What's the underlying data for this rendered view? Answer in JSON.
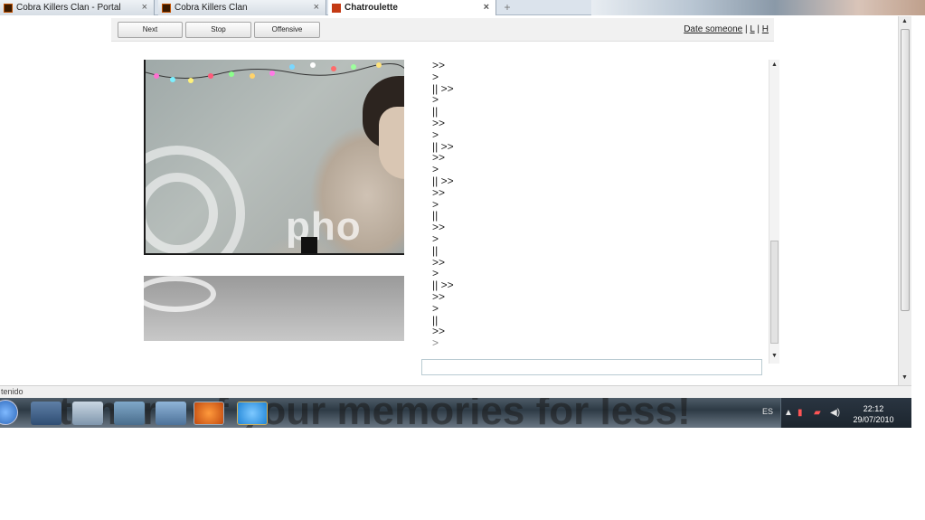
{
  "tabs": [
    {
      "label": "Cobra Killers Clan - Portal",
      "favicon": "cobra-clan-icon"
    },
    {
      "label": "Cobra Killers Clan",
      "favicon": "cobra-clan-icon"
    },
    {
      "label": "Chatroulette",
      "favicon": "chatroulette-icon"
    }
  ],
  "new_tab_glyph": "+",
  "close_glyph": "×",
  "toolbar": {
    "next_label": "Next",
    "stop_label": "Stop",
    "offensive_label": "Offensive",
    "date_link": "Date someone",
    "sep1": " | ",
    "link_l": "L",
    "sep2": " | ",
    "link_h": "H"
  },
  "video": {
    "watermark_text": "pho"
  },
  "chat": {
    "lines": [
      ">>",
      ">",
      "|| >>",
      ">",
      "||",
      ">>",
      ">",
      "|| >>",
      ">>",
      ">",
      "|| >>",
      ">>",
      ">",
      "||",
      ">>",
      ">",
      "||",
      ">>",
      ">",
      "|| >>",
      ">>",
      ">",
      "||",
      ">>",
      ">"
    ]
  },
  "statusbar": {
    "text": "tenido"
  },
  "taskbar": {
    "overlay_text": "at more of your memories for less!"
  },
  "tray": {
    "language": "ES",
    "time": "22:12",
    "date": "29/07/2010"
  },
  "colors": {
    "chatroulette_red": "#c43a14",
    "taskbar_dark": "#2d3a45"
  }
}
